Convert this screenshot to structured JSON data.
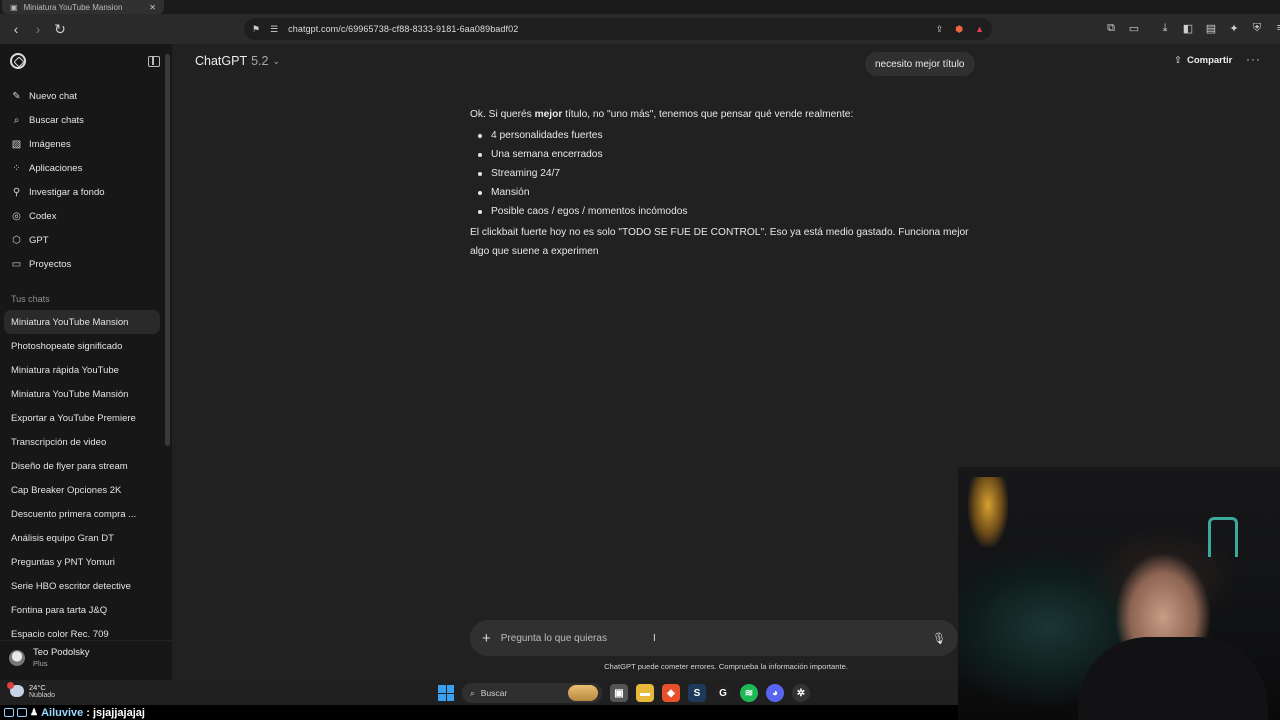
{
  "browser": {
    "tab_title": "Miniatura YouTube Mansion",
    "url": "chatgpt.com/c/69965738-cf88-8333-9181-6aa089badf02"
  },
  "sidebar": {
    "nav": [
      {
        "label": "Nuevo chat",
        "icon": "edit-icon"
      },
      {
        "label": "Buscar chats",
        "icon": "search-icon"
      },
      {
        "label": "Imágenes",
        "icon": "image-icon"
      },
      {
        "label": "Aplicaciones",
        "icon": "apps-icon"
      },
      {
        "label": "Investigar a fondo",
        "icon": "research-icon"
      },
      {
        "label": "Codex",
        "icon": "codex-icon"
      },
      {
        "label": "GPT",
        "icon": "gpt-icon"
      },
      {
        "label": "Proyectos",
        "icon": "folder-icon"
      }
    ],
    "section_label": "Tus chats",
    "chats": [
      "Miniatura YouTube Mansion",
      "Photoshopeate significado",
      "Miniatura rápida YouTube",
      "Miniatura YouTube Mansión",
      "Exportar a YouTube Premiere",
      "Transcripción de video",
      "Diseño de flyer para stream",
      "Cap Breaker Opciones 2K",
      "Descuento primera compra ...",
      "Análisis equipo Gran DT",
      "Preguntas y PNT Yomuri",
      "Serie HBO escritor detective",
      "Fontina para tarta J&Q",
      "Espacio color Rec. 709"
    ],
    "user": {
      "name": "Teo Podolsky",
      "plan": "Plus"
    }
  },
  "header": {
    "model_name": "ChatGPT",
    "model_version": "5.2",
    "share_label": "Compartir"
  },
  "conversation": {
    "user_message": "necesito mejor título",
    "answer": {
      "intro_before": "Ok. Si querés ",
      "intro_bold": "mejor",
      "intro_after": " título, no \"uno más\", tenemos que pensar qué vende realmente:",
      "bullets": [
        "4 personalidades fuertes",
        "Una semana encerrados",
        "Streaming 24/7",
        "Mansión",
        "Posible caos / egos / momentos incómodos"
      ],
      "paragraph": "El clickbait fuerte hoy no es solo \"TODO SE FUE DE CONTROL\". Eso ya está medio gastado. Funciona mejor algo que suene a experimen"
    }
  },
  "composer": {
    "placeholder": "Pregunta lo que quieras",
    "disclaimer": "ChatGPT puede cometer errores. Comprueba la información importante."
  },
  "taskbar": {
    "temperature": "24°C",
    "weather": "Nublado",
    "search_label": "Buscar"
  },
  "stream_chat": {
    "user": "Ailuvive",
    "separator": ":",
    "message": "jsjajjajajaj"
  }
}
